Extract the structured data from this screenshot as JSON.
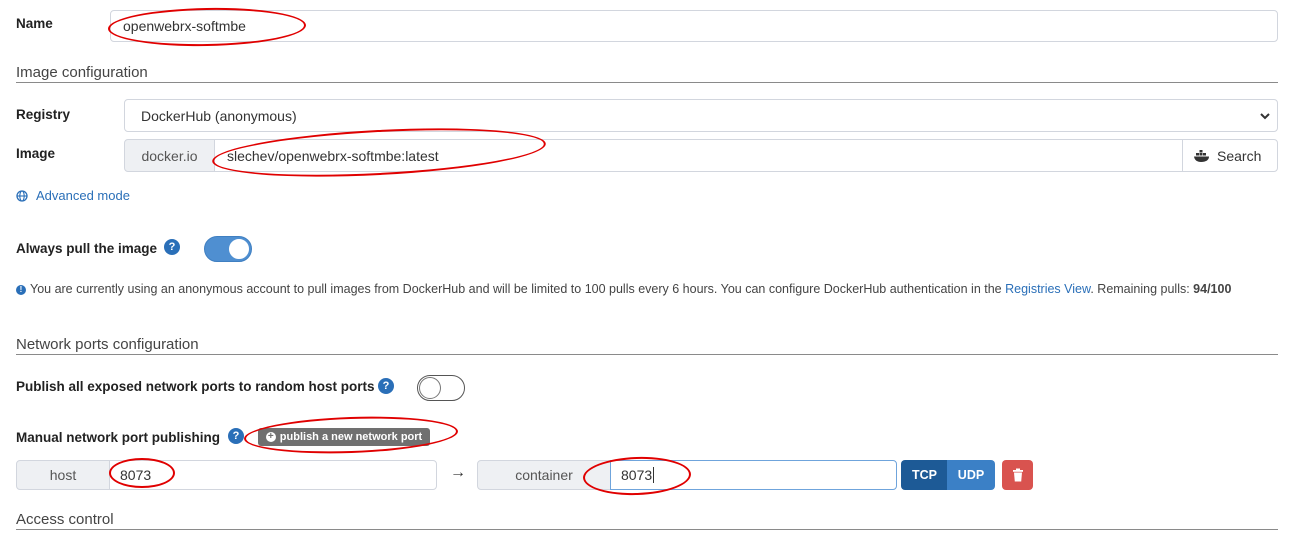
{
  "name": {
    "label": "Name",
    "value": "openwebrx-softmbe"
  },
  "image_config": {
    "section_title": "Image configuration",
    "registry_label": "Registry",
    "registry_selected": "DockerHub (anonymous)",
    "image_label": "Image",
    "image_prefix": "docker.io",
    "image_value": "slechev/openwebrx-softmbe:latest",
    "search_label": "Search",
    "advanced_mode": "Advanced mode"
  },
  "pull": {
    "label": "Always pull the image",
    "help": "?",
    "enabled": true
  },
  "notice": {
    "text_before": "You are currently using an anonymous account to pull images from DockerHub and will be limited to 100 pulls every 6 hours. You can configure DockerHub authentication in the ",
    "link": "Registries View",
    "text_after": ". Remaining pulls: ",
    "remaining": "94/100"
  },
  "network": {
    "section_title": "Network ports configuration",
    "publish_all_label": "Publish all exposed network ports to random host ports",
    "publish_all_enabled": false,
    "manual_label": "Manual network port publishing",
    "publish_new_button": "publish a new network port",
    "host_label": "host",
    "host_value": "8073",
    "arrow": "→",
    "container_label": "container",
    "container_value": "8073",
    "tcp": "TCP",
    "udp": "UDP"
  },
  "access": {
    "section_title": "Access control"
  },
  "colors": {
    "primary": "#2a6fb8",
    "toggle_on": "#4f8fd1",
    "danger": "#d9534f",
    "annotation": "#e00000"
  }
}
